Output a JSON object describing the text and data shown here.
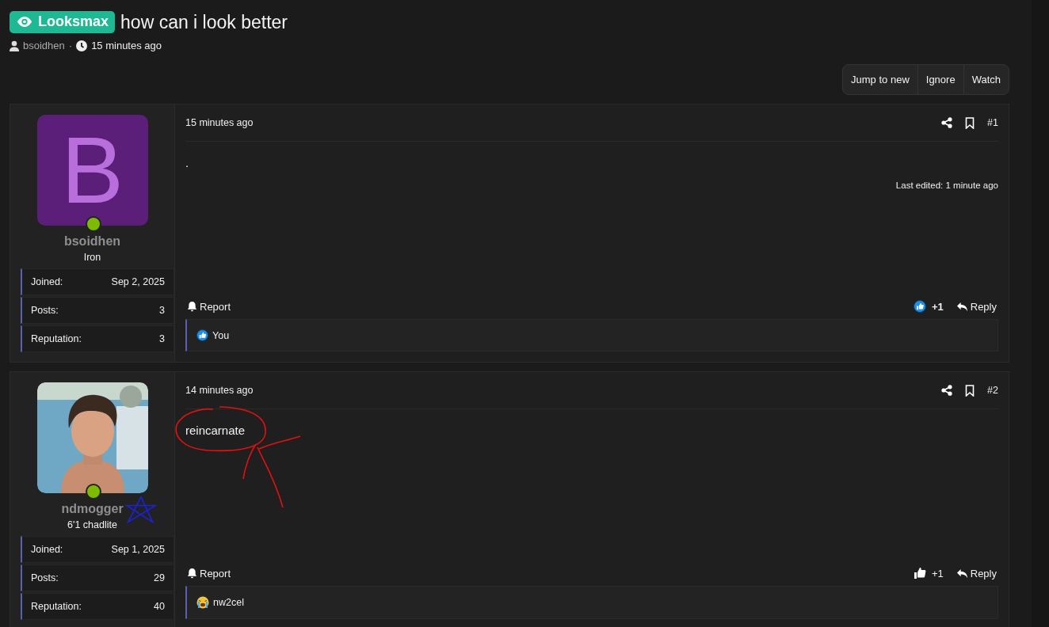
{
  "thread": {
    "prefix": "Looksmax",
    "title": "how can i look better",
    "author": "bsoidhen",
    "separator": "·",
    "time": "15 minutes ago"
  },
  "actions": [
    "Jump to new",
    "Ignore",
    "Watch"
  ],
  "posts": [
    {
      "time": "15 minutes ago",
      "number": "#1",
      "avatar": {
        "kind": "letter",
        "letter": "B"
      },
      "online": true,
      "username": "bsoidhen",
      "user_title": "Iron",
      "stats": [
        {
          "label": "Joined:",
          "value": "Sep 2, 2025"
        },
        {
          "label": "Posts:",
          "value": "3"
        },
        {
          "label": "Reputation:",
          "value": "3"
        }
      ],
      "message": ".",
      "last_edited": "Last edited: 1 minute ago",
      "report": "Report",
      "like_count": "+1",
      "liked": true,
      "reply": "Reply",
      "reactions": {
        "kind": "like",
        "users": "You"
      }
    },
    {
      "time": "14 minutes ago",
      "number": "#2",
      "online": true,
      "username": "ndmogger",
      "user_title": "6'1 chadlite",
      "starred": true,
      "stats": [
        {
          "label": "Joined:",
          "value": "Sep 1, 2025"
        },
        {
          "label": "Posts:",
          "value": "29"
        },
        {
          "label": "Reputation:",
          "value": "40"
        }
      ],
      "message": "reincarnate",
      "annotated": true,
      "report": "Report",
      "like_count": "+1",
      "liked": false,
      "reply": "Reply",
      "reactions": {
        "kind": "cry",
        "users": "nw2cel"
      }
    }
  ]
}
